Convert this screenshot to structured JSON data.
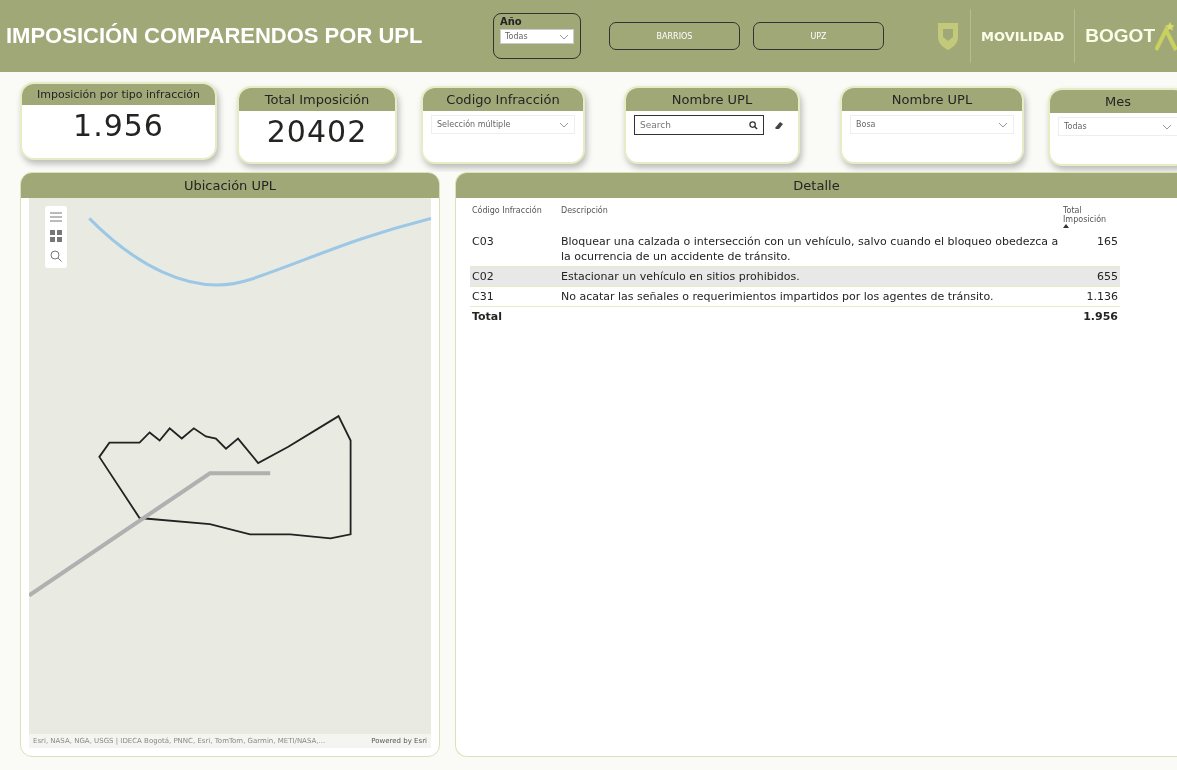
{
  "header": {
    "title": "IMPOSICIÓN COMPARENDOS POR UPL",
    "year_slicer": {
      "label": "Año",
      "value": "Todas"
    },
    "buttons": [
      "BARRIOS",
      "UPZ"
    ],
    "logos": {
      "secretaria": "MOVILIDAD",
      "city": "BOGOT"
    }
  },
  "cards": [
    {
      "kind": "kpi",
      "title": "Imposición por tipo infracción",
      "value": "1.956"
    },
    {
      "kind": "kpi",
      "title": "Total Imposición",
      "value": "20402"
    },
    {
      "kind": "dropdown",
      "title": "Codigo Infracción",
      "value": "Selección múltiple"
    },
    {
      "kind": "search",
      "title": "Nombre UPL",
      "placeholder": "Search"
    },
    {
      "kind": "dropdown",
      "title": "Nombre UPL",
      "value": "Bosa"
    },
    {
      "kind": "dropdown",
      "title": "Mes",
      "value": "Todas"
    }
  ],
  "map": {
    "title": "Ubicación UPL",
    "attribution": "Esri, NASA, NGA, USGS | IDECA Bogotá, PNNC, Esri, TomTom, Garmin, METI/NASA,...",
    "powered_by": "Powered by Esri"
  },
  "detail": {
    "title": "Detalle",
    "columns": [
      "Código Infracción",
      "Descripción",
      "Total Imposición"
    ],
    "rows": [
      {
        "code": "C03",
        "description": "Bloquear una calzada o intersección con un vehículo, salvo cuando el bloqueo obedezca a la ocurrencia de un accidente de tránsito.",
        "total": "165",
        "selected": false
      },
      {
        "code": "C02",
        "description": "Estacionar un vehículo en sitios prohibidos.",
        "total": "655",
        "selected": true
      },
      {
        "code": "C31",
        "description": "No acatar las señales o requerimientos impartidos por los agentes de tránsito.",
        "total": "1.136",
        "selected": false
      }
    ],
    "total": {
      "label": "Total",
      "value": "1.956"
    }
  }
}
